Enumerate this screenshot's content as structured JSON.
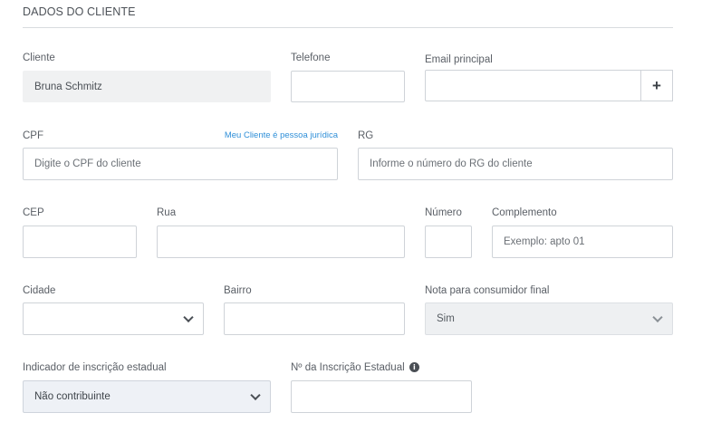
{
  "section": {
    "title": "DADOS DO CLIENTE"
  },
  "cliente": {
    "label": "Cliente",
    "value": "Bruna Schmitz"
  },
  "telefone": {
    "label": "Telefone",
    "value": ""
  },
  "email": {
    "label": "Email principal",
    "value": "",
    "add_label": "+"
  },
  "cpf": {
    "label": "CPF",
    "link": "Meu Cliente é pessoa jurídica",
    "placeholder": "Digite o CPF do cliente"
  },
  "rg": {
    "label": "RG",
    "placeholder": "Informe o número do RG do cliente"
  },
  "cep": {
    "label": "CEP",
    "value": ""
  },
  "rua": {
    "label": "Rua",
    "value": ""
  },
  "numero": {
    "label": "Número",
    "value": ""
  },
  "complemento": {
    "label": "Complemento",
    "placeholder": "Exemplo: apto 01"
  },
  "cidade": {
    "label": "Cidade",
    "value": ""
  },
  "bairro": {
    "label": "Bairro",
    "value": ""
  },
  "nota": {
    "label": "Nota para consumidor final",
    "value": "Sim"
  },
  "indicador": {
    "label": "Indicador de inscrição estadual",
    "value": "Não contribuinte"
  },
  "inscricao": {
    "label": "Nº da Inscrição Estadual",
    "info_icon": "i",
    "value": ""
  },
  "colors": {
    "link": "#2f8fd8",
    "border": "#cfd3d8",
    "readonly_bg": "#f0f1f2"
  },
  "icons": {
    "add": "plus-icon",
    "dropdown": "chevron-down-icon",
    "info": "info-icon"
  }
}
